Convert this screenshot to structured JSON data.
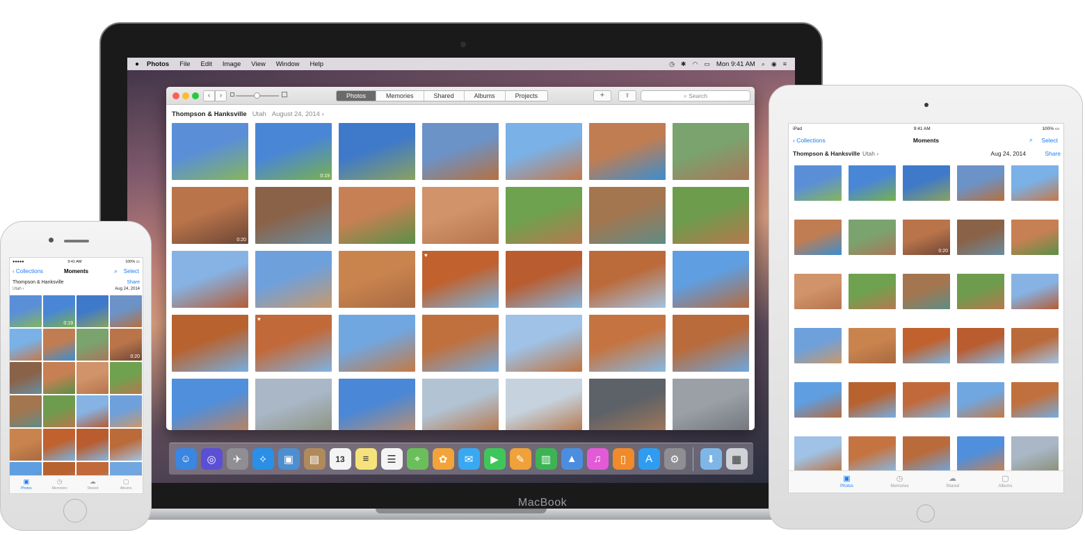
{
  "macbook": {
    "brand_label": "MacBook",
    "menubar": {
      "items": [
        "Photos",
        "File",
        "Edit",
        "Image",
        "View",
        "Window",
        "Help"
      ],
      "clock": "Mon 9:41 AM"
    },
    "window": {
      "tabs": [
        "Photos",
        "Memories",
        "Shared",
        "Albums",
        "Projects"
      ],
      "active_tab": "Photos",
      "search_placeholder": "Search",
      "moment_title": "Thompson & Hanksville",
      "moment_location": "Utah",
      "moment_date": "August 24, 2014 ›"
    },
    "photos": [
      {
        "colors": [
          "#5a8fd8",
          "#86b55b"
        ]
      },
      {
        "colors": [
          "#4a86d6",
          "#79b04e"
        ],
        "duration": "0:19"
      },
      {
        "colors": [
          "#3f79c9",
          "#8aa25e"
        ]
      },
      {
        "colors": [
          "#6b93c8",
          "#b6703f"
        ]
      },
      {
        "colors": [
          "#7ab1e6",
          "#c5784a"
        ]
      },
      {
        "colors": [
          "#c17d52",
          "#3a8ed0"
        ]
      },
      {
        "colors": [
          "#7aa36e",
          "#a9775a"
        ]
      },
      {
        "colors": [
          "#b9744a",
          "#6c4636"
        ],
        "duration": "0:20"
      },
      {
        "colors": [
          "#8a6248",
          "#6b8da0"
        ]
      },
      {
        "colors": [
          "#c78053",
          "#5a8f48"
        ]
      },
      {
        "colors": [
          "#d0936a",
          "#b7744d"
        ]
      },
      {
        "colors": [
          "#6ea24e",
          "#b4794f"
        ]
      },
      {
        "colors": [
          "#a3764f",
          "#5f8c86"
        ]
      },
      {
        "colors": [
          "#6d9c4d",
          "#b6784d"
        ]
      },
      {
        "colors": [
          "#86b3e4",
          "#b45c34"
        ]
      },
      {
        "colors": [
          "#6ea0dc",
          "#c8996a"
        ]
      },
      {
        "colors": [
          "#c9844e",
          "#a96a42"
        ]
      },
      {
        "colors": [
          "#c0612e",
          "#7ab4e0"
        ],
        "heart": "♥"
      },
      {
        "colors": [
          "#b95c2f",
          "#85b7e2"
        ]
      },
      {
        "colors": [
          "#bb6a3a",
          "#a3c3e3"
        ]
      },
      {
        "colors": [
          "#5f9ee0",
          "#b76a3c"
        ]
      },
      {
        "colors": [
          "#b8622f",
          "#76aee0"
        ]
      },
      {
        "colors": [
          "#c2693a",
          "#7db3e3"
        ],
        "heart": "♥"
      },
      {
        "colors": [
          "#70a7e0",
          "#c47a45"
        ]
      },
      {
        "colors": [
          "#c0703d",
          "#76acdf"
        ]
      },
      {
        "colors": [
          "#9fc2e6",
          "#bd7442"
        ]
      },
      {
        "colors": [
          "#c57441",
          "#86b9e4"
        ]
      },
      {
        "colors": [
          "#b96b3b",
          "#6da7df"
        ]
      },
      {
        "colors": [
          "#4f8fdc",
          "#c88150"
        ]
      },
      {
        "colors": [
          "#a9b7c6",
          "#8a8f7a"
        ]
      },
      {
        "colors": [
          "#4a87d6",
          "#c59066"
        ]
      },
      {
        "colors": [
          "#b2c3d4",
          "#b8703f"
        ]
      },
      {
        "colors": [
          "#c6d3df",
          "#b46f40"
        ]
      },
      {
        "colors": [
          "#5d6168",
          "#a77a58"
        ]
      },
      {
        "colors": [
          "#9aa0a6",
          "#6f7379"
        ]
      }
    ],
    "dock": [
      {
        "icon": "finder-icon",
        "glyph": "☺",
        "color": "#3a86e0"
      },
      {
        "icon": "siri-icon",
        "glyph": "◎",
        "color": "#5b4fd4"
      },
      {
        "icon": "launchpad-icon",
        "glyph": "✈",
        "color": "#8e8e93"
      },
      {
        "icon": "safari-icon",
        "glyph": "✧",
        "color": "#2a8fe6"
      },
      {
        "icon": "preview-icon",
        "glyph": "▣",
        "color": "#4d8ed0"
      },
      {
        "icon": "contacts-icon",
        "glyph": "▤",
        "color": "#b08a5a"
      },
      {
        "icon": "calendar-icon",
        "glyph": "13",
        "color": "#f4f4f4"
      },
      {
        "icon": "notes-icon",
        "glyph": "≡",
        "color": "#f6e27a"
      },
      {
        "icon": "reminders-icon",
        "glyph": "☰",
        "color": "#f4f4f4"
      },
      {
        "icon": "maps-icon",
        "glyph": "⌖",
        "color": "#6bbf5a"
      },
      {
        "icon": "photos-icon",
        "glyph": "✿",
        "color": "#f2a33a"
      },
      {
        "icon": "messages-icon",
        "glyph": "✉",
        "color": "#39a8f2"
      },
      {
        "icon": "facetime-icon",
        "glyph": "▶",
        "color": "#3fc65a"
      },
      {
        "icon": "pages-icon",
        "glyph": "✎",
        "color": "#f0a13a"
      },
      {
        "icon": "numbers-icon",
        "glyph": "▥",
        "color": "#3cb453"
      },
      {
        "icon": "keynote-icon",
        "glyph": "▲",
        "color": "#4b8ee0"
      },
      {
        "icon": "itunes-icon",
        "glyph": "♫",
        "color": "#e35ad6"
      },
      {
        "icon": "ibooks-icon",
        "glyph": "▯",
        "color": "#f08a2a"
      },
      {
        "icon": "app-store-icon",
        "glyph": "A",
        "color": "#2f9cf0"
      },
      {
        "icon": "system-preferences-icon",
        "glyph": "⚙",
        "color": "#8e8e93"
      },
      {
        "icon": "downloads-folder-icon",
        "glyph": "⬇",
        "color": "#7fb6e8"
      },
      {
        "icon": "trash-icon",
        "glyph": "▦",
        "color": "#cfd3d8"
      }
    ]
  },
  "ipad": {
    "status_left": "iPad ",
    "status_time": "9:41 AM",
    "status_battery": "100% ▭",
    "nav_back": "‹ Collections",
    "nav_title": "Moments",
    "nav_search": "⌕",
    "nav_select": "Select",
    "moment_title": "Thompson & Hanksville",
    "moment_location": "Utah ›",
    "moment_date": "Aug 24, 2014",
    "moment_share": "Share",
    "tabs": [
      {
        "label": "Photos",
        "glyph": "▣",
        "active": true
      },
      {
        "label": "Memories",
        "glyph": "◷",
        "active": false
      },
      {
        "label": "Shared",
        "glyph": "☁",
        "active": false
      },
      {
        "label": "Albums",
        "glyph": "▢",
        "active": false
      }
    ],
    "photos": [
      {
        "colors": [
          "#5a8fd8",
          "#86b55b"
        ]
      },
      {
        "colors": [
          "#4a86d6",
          "#79b04e"
        ]
      },
      {
        "colors": [
          "#3f79c9",
          "#8aa25e"
        ]
      },
      {
        "colors": [
          "#6b93c8",
          "#b6703f"
        ]
      },
      {
        "colors": [
          "#7ab1e6",
          "#c5784a"
        ]
      },
      {
        "colors": [
          "#c17d52",
          "#3a8ed0"
        ]
      },
      {
        "colors": [
          "#7aa36e",
          "#a9775a"
        ]
      },
      {
        "colors": [
          "#b9744a",
          "#6c4636"
        ],
        "duration": "0:20"
      },
      {
        "colors": [
          "#8a6248",
          "#6b8da0"
        ]
      },
      {
        "colors": [
          "#c78053",
          "#5a8f48"
        ]
      },
      {
        "colors": [
          "#d0936a",
          "#b7744d"
        ]
      },
      {
        "colors": [
          "#6ea24e",
          "#b4794f"
        ]
      },
      {
        "colors": [
          "#a3764f",
          "#5f8c86"
        ]
      },
      {
        "colors": [
          "#6d9c4d",
          "#b6784d"
        ]
      },
      {
        "colors": [
          "#86b3e4",
          "#b45c34"
        ]
      },
      {
        "colors": [
          "#6ea0dc",
          "#c8996a"
        ]
      },
      {
        "colors": [
          "#c9844e",
          "#a96a42"
        ]
      },
      {
        "colors": [
          "#c0612e",
          "#7ab4e0"
        ]
      },
      {
        "colors": [
          "#b95c2f",
          "#85b7e2"
        ]
      },
      {
        "colors": [
          "#bb6a3a",
          "#a3c3e3"
        ]
      },
      {
        "colors": [
          "#5f9ee0",
          "#b76a3c"
        ]
      },
      {
        "colors": [
          "#b8622f",
          "#76aee0"
        ]
      },
      {
        "colors": [
          "#c2693a",
          "#7db3e3"
        ]
      },
      {
        "colors": [
          "#70a7e0",
          "#c47a45"
        ]
      },
      {
        "colors": [
          "#c0703d",
          "#76acdf"
        ]
      },
      {
        "colors": [
          "#9fc2e6",
          "#bd7442"
        ]
      },
      {
        "colors": [
          "#c57441",
          "#86b9e4"
        ]
      },
      {
        "colors": [
          "#b96b3b",
          "#6da7df"
        ]
      },
      {
        "colors": [
          "#4f8fdc",
          "#c88150"
        ]
      },
      {
        "colors": [
          "#a9b7c6",
          "#8a8f7a"
        ]
      }
    ]
  },
  "iphone": {
    "status_left": "●●●●● ",
    "status_time": "9:41 AM",
    "status_battery": "100% ▭",
    "nav_back": "‹ Collections",
    "nav_title": "Moments",
    "nav_search": "⌕",
    "nav_select": "Select",
    "moment_title": "Thompson & Hanksville",
    "moment_location": "Utah ›",
    "moment_share": "Share",
    "moment_date": "Aug 24, 2014",
    "tabs": [
      {
        "label": "Photos",
        "glyph": "▣",
        "active": true
      },
      {
        "label": "Memories",
        "glyph": "◷",
        "active": false
      },
      {
        "label": "Shared",
        "glyph": "☁",
        "active": false
      },
      {
        "label": "Albums",
        "glyph": "▢",
        "active": false
      }
    ],
    "photos": [
      {
        "colors": [
          "#5a8fd8",
          "#86b55b"
        ]
      },
      {
        "colors": [
          "#4a86d6",
          "#79b04e"
        ],
        "duration": "0:19"
      },
      {
        "colors": [
          "#3f79c9",
          "#8aa25e"
        ]
      },
      {
        "colors": [
          "#6b93c8",
          "#b6703f"
        ]
      },
      {
        "colors": [
          "#7ab1e6",
          "#c5784a"
        ]
      },
      {
        "colors": [
          "#c17d52",
          "#3a8ed0"
        ]
      },
      {
        "colors": [
          "#7aa36e",
          "#a9775a"
        ]
      },
      {
        "colors": [
          "#b9744a",
          "#6c4636"
        ],
        "duration": "0:20"
      },
      {
        "colors": [
          "#8a6248",
          "#6b8da0"
        ]
      },
      {
        "colors": [
          "#c78053",
          "#5a8f48"
        ]
      },
      {
        "colors": [
          "#d0936a",
          "#b7744d"
        ]
      },
      {
        "colors": [
          "#6ea24e",
          "#b4794f"
        ]
      },
      {
        "colors": [
          "#a3764f",
          "#5f8c86"
        ]
      },
      {
        "colors": [
          "#6d9c4d",
          "#b6784d"
        ]
      },
      {
        "colors": [
          "#86b3e4",
          "#b45c34"
        ]
      },
      {
        "colors": [
          "#6ea0dc",
          "#c8996a"
        ]
      },
      {
        "colors": [
          "#c9844e",
          "#a96a42"
        ]
      },
      {
        "colors": [
          "#c0612e",
          "#7ab4e0"
        ]
      },
      {
        "colors": [
          "#b95c2f",
          "#85b7e2"
        ]
      },
      {
        "colors": [
          "#bb6a3a",
          "#a3c3e3"
        ]
      },
      {
        "colors": [
          "#5f9ee0",
          "#b76a3c"
        ]
      },
      {
        "colors": [
          "#b8622f",
          "#76aee0"
        ]
      },
      {
        "colors": [
          "#c2693a",
          "#7db3e3"
        ]
      },
      {
        "colors": [
          "#70a7e0",
          "#c47a45"
        ]
      }
    ]
  }
}
